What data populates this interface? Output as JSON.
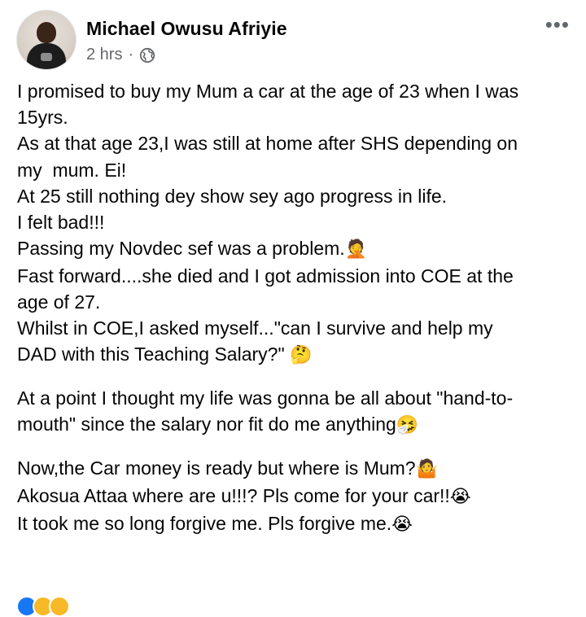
{
  "post": {
    "author": "Michael Owusu Afriyie",
    "time": "2 hrs",
    "separator": "·",
    "more_label": "•••",
    "lines": [
      "I promised to buy my Mum a car at the age of 23 when I was",
      "15yrs.",
      "As at that age 23,I was still at home after SHS depending on",
      "my  mum. Ei!",
      "At 25 still nothing dey show sey ago progress in life.",
      "I felt bad!!!",
      "Passing my Novdec sef was a problem.",
      "Fast forward....she died and I got admission into COE at the",
      "age of 27.",
      "Whilst in COE,I asked myself...\"can I survive and help my",
      "DAD with this Teaching Salary?\"",
      "At a point I thought my life was gonna be all about \"hand-to-",
      "mouth\" since the salary nor fit do me anything",
      "Now,the Car money is ready but where is Mum?",
      "Akosua Attaa where are u!!!? Pls come for your car!!",
      "It took me so long forgive me. Pls forgive me."
    ],
    "emojis": {
      "facepalm": "🤦",
      "thinking": "🤔",
      "sneeze": "🤧",
      "shrug": "🤷",
      "crying": "😭"
    }
  },
  "colors": {
    "text": "#050505",
    "meta": "#65676b",
    "like_blue": "#1877f2",
    "haha_yellow": "#f7b928"
  }
}
